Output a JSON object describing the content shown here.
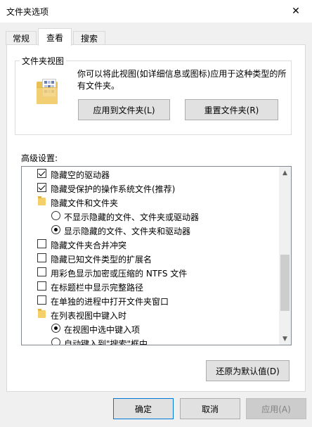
{
  "window": {
    "title": "文件夹选项",
    "close_glyph": "✕"
  },
  "tabs": [
    {
      "label": "常规",
      "active": false
    },
    {
      "label": "查看",
      "active": true
    },
    {
      "label": "搜索",
      "active": false
    }
  ],
  "folder_views": {
    "group_label": "文件夹视图",
    "description": "你可以将此视图(如详细信息或图标)应用于这种类型的所有文件夹。",
    "apply_button": "应用到文件夹(L)",
    "reset_button": "重置文件夹(R)"
  },
  "advanced": {
    "label": "高级设置:",
    "items": [
      {
        "type": "checkbox",
        "checked": true,
        "label": "隐藏空的驱动器"
      },
      {
        "type": "checkbox",
        "checked": true,
        "label": "隐藏受保护的操作系统文件(推荐)"
      },
      {
        "type": "folder",
        "label": "隐藏文件和文件夹"
      },
      {
        "type": "radio",
        "checked": false,
        "label": "不显示隐藏的文件、文件夹或驱动器"
      },
      {
        "type": "radio",
        "checked": true,
        "label": "显示隐藏的文件、文件夹和驱动器"
      },
      {
        "type": "checkbox",
        "checked": false,
        "label": "隐藏文件夹合并冲突"
      },
      {
        "type": "checkbox",
        "checked": false,
        "label": "隐藏已知文件类型的扩展名"
      },
      {
        "type": "checkbox",
        "checked": false,
        "label": "用彩色显示加密或压缩的 NTFS 文件"
      },
      {
        "type": "checkbox",
        "checked": false,
        "label": "在标题栏中显示完整路径"
      },
      {
        "type": "checkbox",
        "checked": false,
        "label": "在单独的进程中打开文件夹窗口"
      },
      {
        "type": "folder",
        "label": "在列表视图中键入时"
      },
      {
        "type": "radio",
        "checked": true,
        "label": "在视图中选中键入项"
      },
      {
        "type": "radio",
        "checked": false,
        "label": "自动键入到\"搜索\"框中"
      }
    ],
    "restore_button": "还原为默认值(D)"
  },
  "footer": {
    "ok": "确定",
    "cancel": "取消",
    "apply": "应用(A)"
  },
  "colors": {
    "accent": "#0078d7",
    "dialog_bg": "#f0f0f0",
    "folder": "#f4cf6a"
  }
}
